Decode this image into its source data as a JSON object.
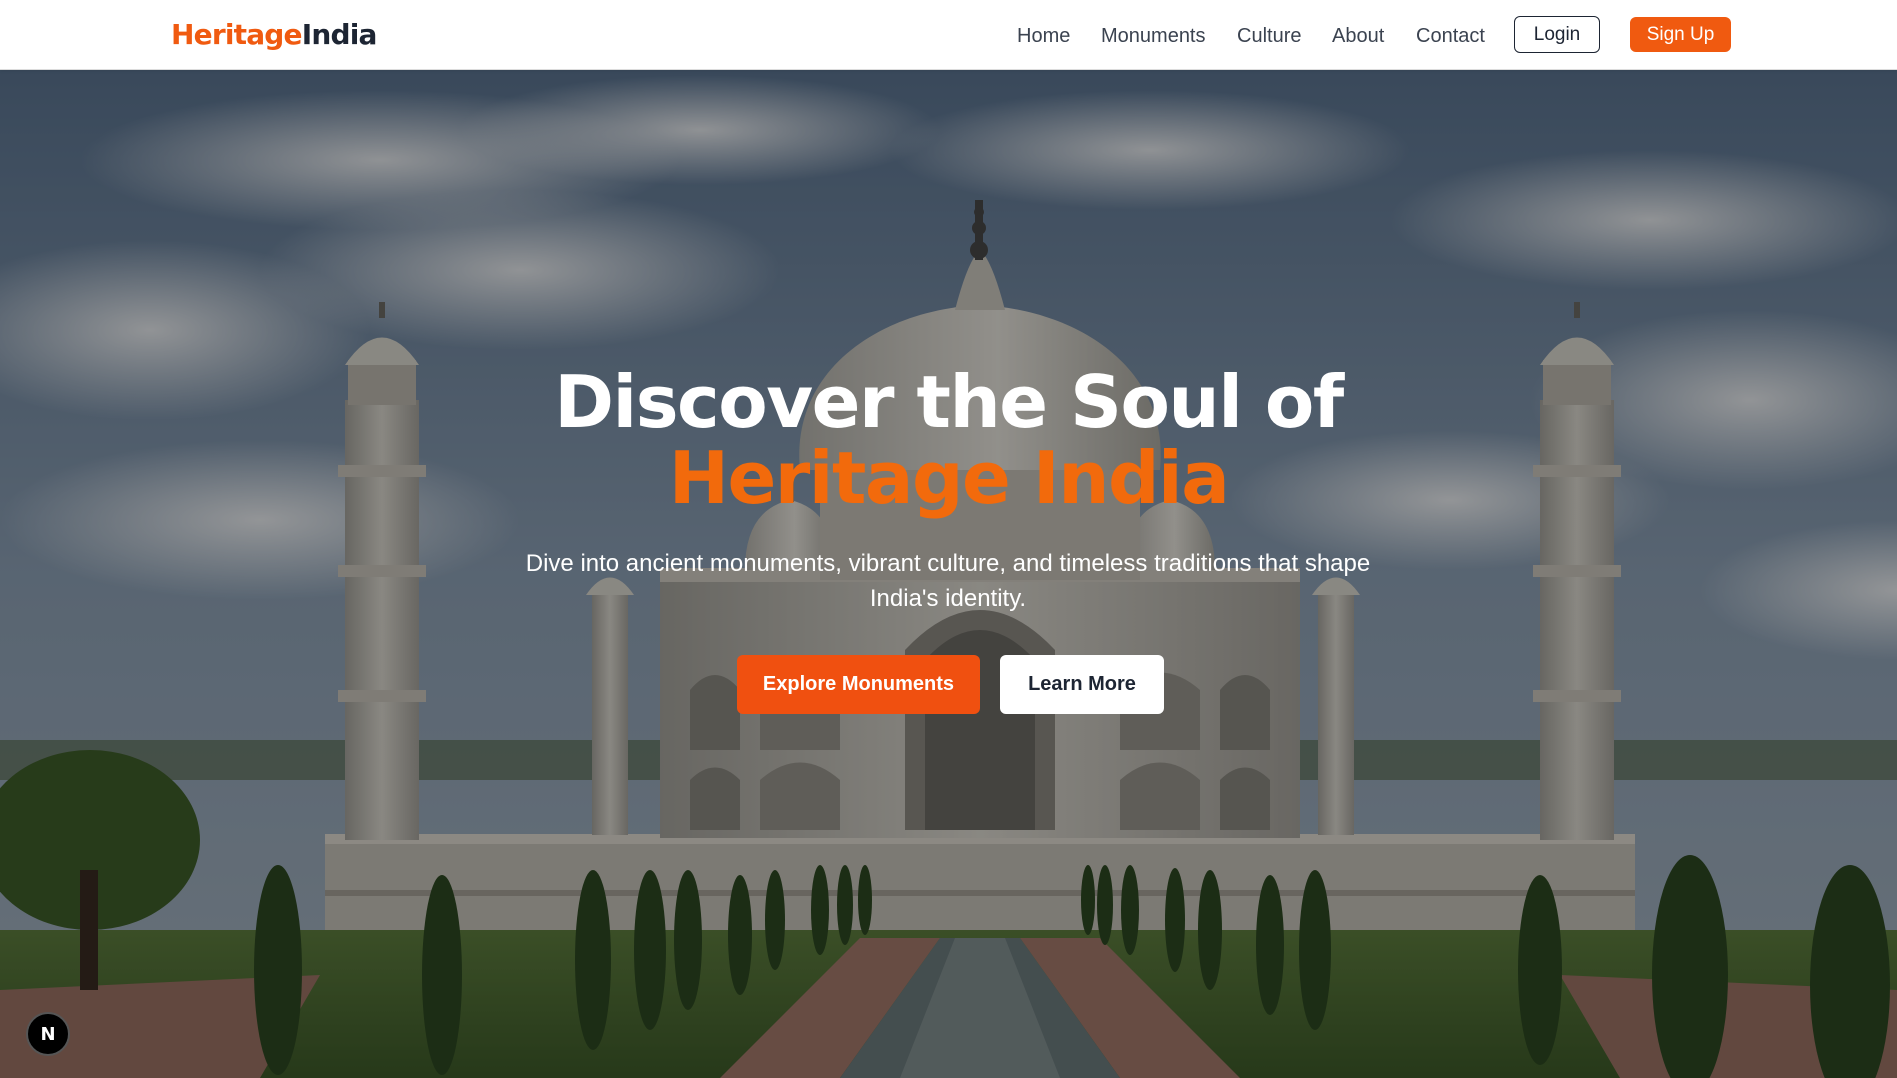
{
  "brand": {
    "part1": "Heritage",
    "part2": "India",
    "accent_color": "#f05a10",
    "dark_color": "#1d2533"
  },
  "nav": {
    "links": [
      "Home",
      "Monuments",
      "Culture",
      "About",
      "Contact"
    ],
    "login_label": "Login",
    "signup_label": "Sign Up"
  },
  "hero": {
    "background": "taj-mahal-photo",
    "title_line1": "Discover the Soul of",
    "title_line2": "Heritage India",
    "subtitle": "Dive into ancient monuments, vibrant culture, and timeless traditions that shape India's identity.",
    "primary_button": "Explore Monuments",
    "secondary_button": "Learn More"
  },
  "badge": {
    "letter": "N"
  }
}
